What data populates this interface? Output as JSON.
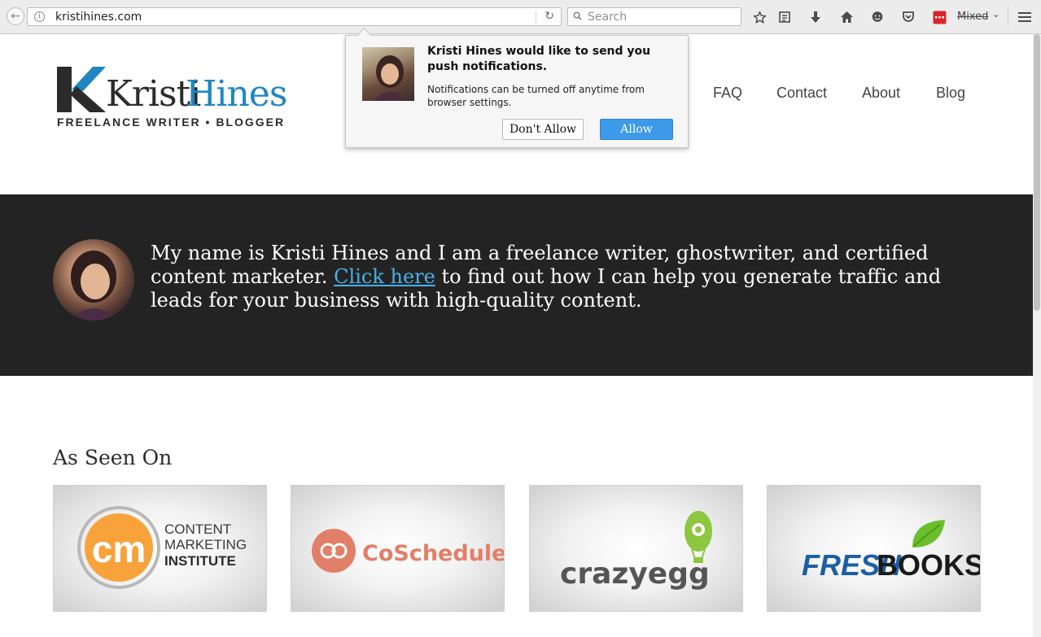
{
  "browser": {
    "url": "kristihines.com",
    "search_placeholder": "Search",
    "mixed_label": "Mixed",
    "toolbar_icons": [
      "back-icon",
      "info-icon",
      "reload-icon",
      "search-icon",
      "bookmark-star-icon",
      "reading-list-icon",
      "download-icon",
      "home-icon",
      "chat-icon",
      "pocket-icon",
      "extension-icon",
      "menu-icon"
    ]
  },
  "site": {
    "logo_name_a": "Kristi",
    "logo_name_b": "Hines",
    "logo_tagline": "FREELANCE WRITER • BLOGGER",
    "nav": [
      "FAQ",
      "Contact",
      "About",
      "Blog"
    ]
  },
  "notification": {
    "title": "Kristi Hines would like to send you push notifications.",
    "body": "Notifications can be turned off anytime from browser settings.",
    "deny_label": "Don't Allow",
    "allow_label": "Allow"
  },
  "intro": {
    "text_before": "My name is Kristi Hines and I am a freelance writer, ghostwriter, and certified content marketer. ",
    "link_text": "Click here",
    "text_after": " to find out how I can help you generate traffic and leads for your business with high-quality content."
  },
  "seen_on": {
    "title": "As Seen On",
    "cmi_initials": "cm",
    "cmi_line1": "CONTENT",
    "cmi_line2": "MARKETING",
    "cmi_line3": "INSTITUTE",
    "coschedule": "CoSchedule",
    "crazyegg": "crazyegg",
    "crazyegg_tm": "™",
    "freshbooks_a": "FRESH",
    "freshbooks_b": "BOOKS"
  },
  "colors": {
    "brand_blue": "#1f86c1",
    "link_blue": "#48b0e8",
    "band_bg": "#232323",
    "allow_blue": "#3d9ae8",
    "cmi_orange": "#f7a23b",
    "coschedule_coral": "#e27f68",
    "crazyegg_green": "#8dc63f",
    "freshbooks_blue": "#1d5fa5",
    "freshbooks_leaf": "#6cbf2c"
  }
}
